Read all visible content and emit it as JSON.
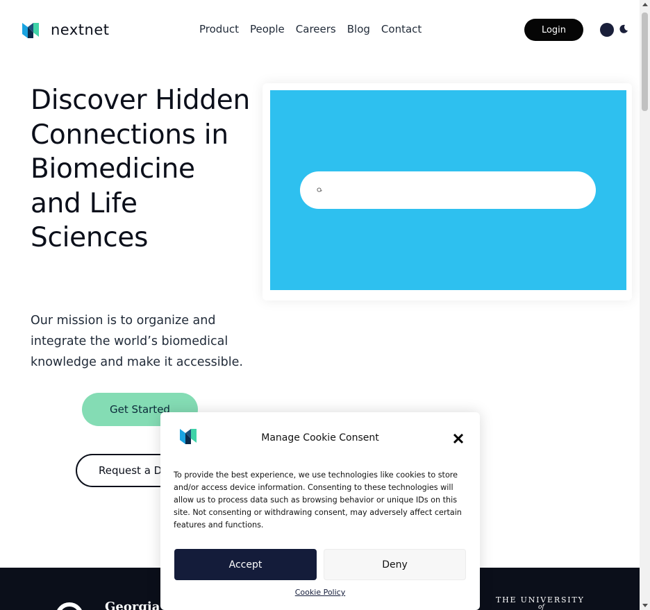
{
  "header": {
    "brand": "nextnet",
    "nav": [
      "Product",
      "People",
      "Careers",
      "Blog",
      "Contact"
    ],
    "login_label": "Login"
  },
  "hero": {
    "title": "Discover Hidden Connections in Biomedicine and Life Sciences",
    "subtitle": "Our mission is to organize and integrate the world’s biomedical knowledge and make it accessible.",
    "get_started_label": "Get Started",
    "request_demo_label": "Request a De"
  },
  "partners": {
    "georgia": "Georgia",
    "university": "THE UNIVERSITY",
    "of": "of"
  },
  "cookie": {
    "title": "Manage Cookie Consent",
    "body": "To provide the best experience, we use technologies like cookies to store and/or access device information. Consenting to these technologies will allow us to process data such as browsing behavior or unique IDs on this site. Not consenting or withdrawing consent, may adversely affect certain features and functions.",
    "accept_label": "Accept",
    "deny_label": "Deny",
    "policy_label": "Cookie Policy"
  },
  "colors": {
    "accent_green": "#84dcb4",
    "demo_blue": "#2ec0ef",
    "dark_navy": "#141c3a",
    "brand_blue": "#1aa3e0"
  },
  "icons": [
    "nextnet-logo-icon",
    "moon-icon",
    "search-icon",
    "close-icon"
  ]
}
